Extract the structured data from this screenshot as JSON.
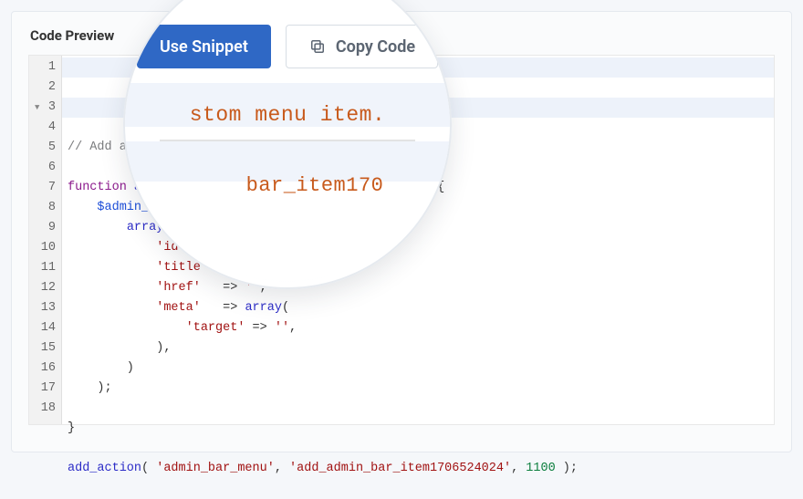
{
  "panel": {
    "title": "Code Preview"
  },
  "actions": {
    "use_snippet": "Use Snippet",
    "copy_code": "Copy Code"
  },
  "magnified": {
    "line1": "stom menu item.",
    "line2": "bar_item170"
  },
  "code": {
    "lines": [
      {
        "ln": 1,
        "tokens": [
          [
            "comment",
            "// Add a "
          ]
        ]
      },
      {
        "ln": 2,
        "tokens": []
      },
      {
        "ln": 3,
        "fold": true,
        "tokens": [
          [
            "kw",
            "function "
          ],
          [
            "fn",
            "add_"
          ],
          [
            "plain",
            "                                     {"
          ]
        ]
      },
      {
        "ln": 4,
        "tokens": [
          [
            "plain",
            "    "
          ],
          [
            "var",
            "$admin_bar"
          ]
        ]
      },
      {
        "ln": 5,
        "tokens": [
          [
            "plain",
            "        "
          ],
          [
            "fn",
            "array"
          ],
          [
            "plain",
            "("
          ]
        ]
      },
      {
        "ln": 6,
        "tokens": [
          [
            "plain",
            "            "
          ],
          [
            "str",
            "'id'"
          ],
          [
            "plain",
            "     => "
          ]
        ]
      },
      {
        "ln": 7,
        "tokens": [
          [
            "plain",
            "            "
          ],
          [
            "str",
            "'title'"
          ],
          [
            "plain",
            "  => "
          ],
          [
            "str",
            "''"
          ],
          [
            "plain",
            ","
          ]
        ]
      },
      {
        "ln": 8,
        "tokens": [
          [
            "plain",
            "            "
          ],
          [
            "str",
            "'href'"
          ],
          [
            "plain",
            "   => "
          ],
          [
            "str",
            "''"
          ],
          [
            "plain",
            ","
          ]
        ]
      },
      {
        "ln": 9,
        "tokens": [
          [
            "plain",
            "            "
          ],
          [
            "str",
            "'meta'"
          ],
          [
            "plain",
            "   => "
          ],
          [
            "fn",
            "array"
          ],
          [
            "plain",
            "("
          ]
        ]
      },
      {
        "ln": 10,
        "tokens": [
          [
            "plain",
            "                "
          ],
          [
            "str",
            "'target'"
          ],
          [
            "plain",
            " => "
          ],
          [
            "str",
            "''"
          ],
          [
            "plain",
            ","
          ]
        ]
      },
      {
        "ln": 11,
        "tokens": [
          [
            "plain",
            "            ),"
          ]
        ]
      },
      {
        "ln": 12,
        "tokens": [
          [
            "plain",
            "        )"
          ]
        ]
      },
      {
        "ln": 13,
        "tokens": [
          [
            "plain",
            "    );"
          ]
        ]
      },
      {
        "ln": 14,
        "tokens": []
      },
      {
        "ln": 15,
        "tokens": [
          [
            "plain",
            "}"
          ]
        ]
      },
      {
        "ln": 16,
        "tokens": []
      },
      {
        "ln": 17,
        "tokens": [
          [
            "fn",
            "add_action"
          ],
          [
            "plain",
            "( "
          ],
          [
            "str",
            "'admin_bar_menu'"
          ],
          [
            "plain",
            ", "
          ],
          [
            "str",
            "'add_admin_bar_item1706524024'"
          ],
          [
            "plain",
            ", "
          ],
          [
            "num",
            "1100"
          ],
          [
            "plain",
            " );"
          ]
        ]
      },
      {
        "ln": 18,
        "tokens": []
      }
    ]
  }
}
